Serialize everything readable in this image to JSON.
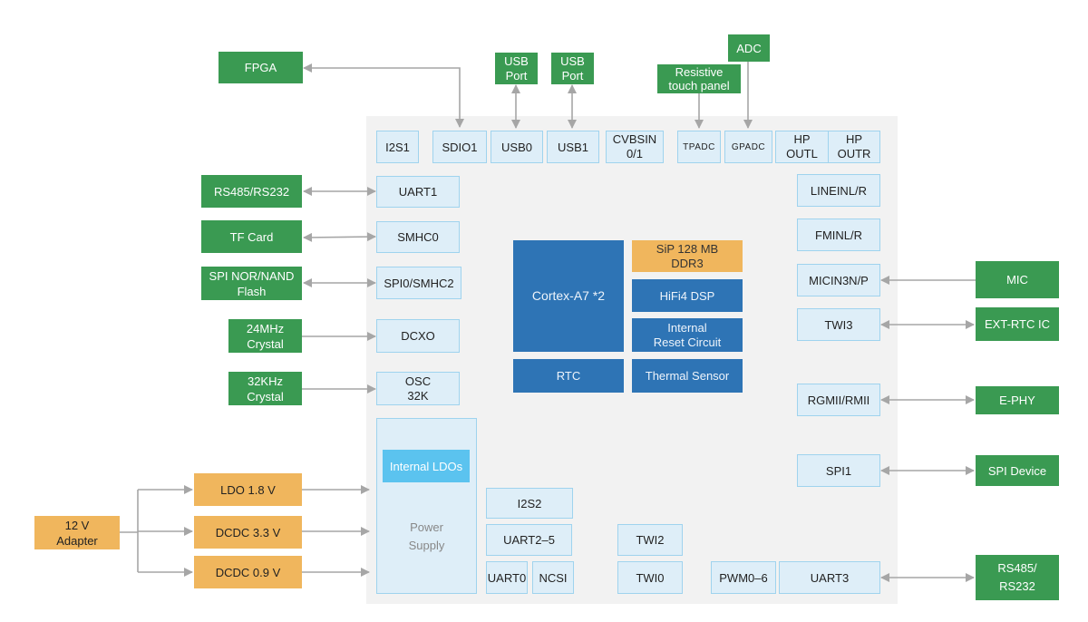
{
  "external": {
    "fpga": "FPGA",
    "usb_port_0": "USB\nPort",
    "usb_port_1": "USB\nPort",
    "resistive_touch": "Resistive\ntouch panel",
    "adc": "ADC",
    "rs485_left": "RS485/RS232",
    "tf_card": "TF Card",
    "spi_flash": "SPI NOR/NAND\nFlash",
    "crystal_24m": "24MHz\nCrystal",
    "crystal_32k": "32KHz\nCrystal",
    "mic": "MIC",
    "ext_rtc": "EXT-RTC IC",
    "ephy": "E-PHY",
    "spi_device": "SPI Device",
    "rs485_right": "RS485/\nRS232"
  },
  "power": {
    "adapter": "12 V\nAdapter",
    "ldo18": "LDO 1.8 V",
    "dcdc33": "DCDC 3.3 V",
    "dcdc09": "DCDC 0.9 V",
    "internal_ldos": "Internal LDOs",
    "power_supply": "Power\nSupply"
  },
  "peripherals": {
    "i2s1": "I2S1",
    "sdio1": "SDIO1",
    "usb0": "USB0",
    "usb1": "USB1",
    "cvbsin": "CVBSIN\n0/1",
    "tpadc": "TPADC",
    "gpadc": "GPADC",
    "hp_outl": "HP\nOUTL",
    "hp_outr": "HP\nOUTR",
    "uart1": "UART1",
    "smhc0": "SMHC0",
    "spi0_smhc2": "SPI0/SMHC2",
    "dcxo": "DCXO",
    "osc32k": "OSC\n32K",
    "linein": "LINEINL/R",
    "fmin": "FMINL/R",
    "micin": "MICIN3N/P",
    "twi3": "TWI3",
    "rgmii": "RGMII/RMII",
    "spi1": "SPI1",
    "i2s2": "I2S2",
    "uart2_5": "UART2–5",
    "uart0": "UART0",
    "ncsi": "NCSI",
    "twi2": "TWI2",
    "twi0": "TWI0",
    "pwm": "PWM0–6",
    "uart3": "UART3"
  },
  "core": {
    "cpu": "Cortex-A7 *2",
    "ddr": "SiP 128 MB\nDDR3",
    "dsp": "HiFi4 DSP",
    "reset": "Internal\nReset Circuit",
    "rtc": "RTC",
    "thermal": "Thermal Sensor"
  },
  "colors": {
    "external": "#3a9a52",
    "power": "#f0b65d",
    "core": "#2e74b5",
    "peripheral": "#deeef8",
    "ldo": "#5bc3ef",
    "wire": "#a6a6a6"
  }
}
